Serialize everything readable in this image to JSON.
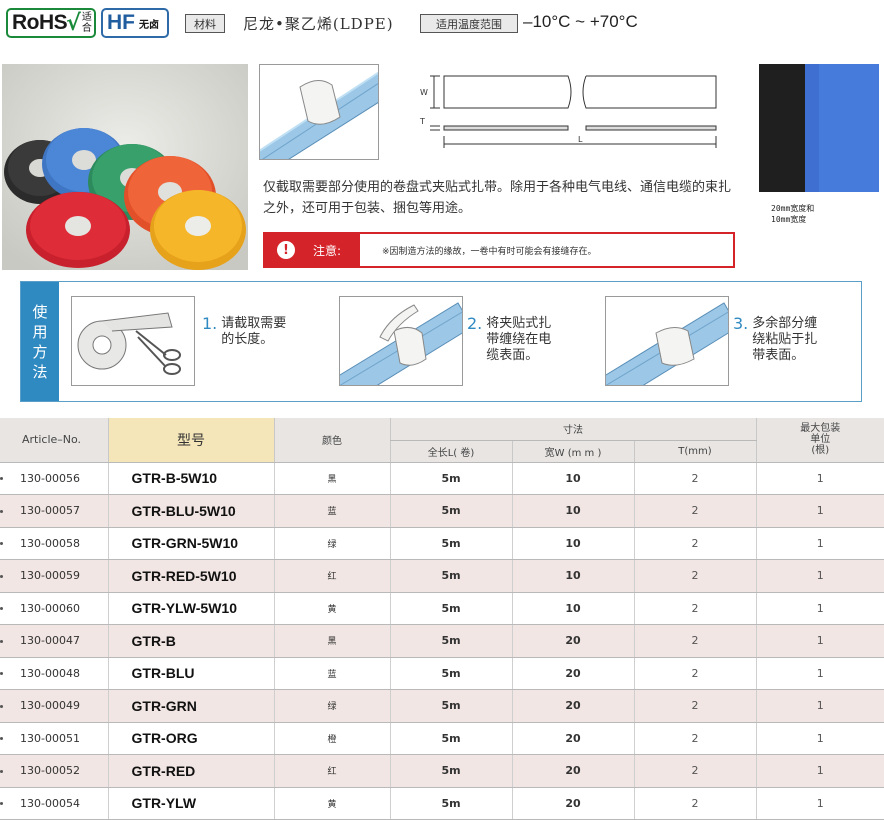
{
  "header": {
    "rohs_text": "RoHS",
    "rohs_mark": "√",
    "rohs_sub_1": "适",
    "rohs_sub_2": "合",
    "hf_text": "HF",
    "hf_sub": "无卤",
    "material_label": "材料",
    "material_value": "尼龙•聚乙烯(LDPE)",
    "temp_label": "适用温度范围",
    "temp_value": "–10°C ~ +70°C"
  },
  "drawing": {
    "w_label": "W",
    "t_label": "T",
    "l_label": "L"
  },
  "side_caption": [
    "20mm宽度和",
    "10mm宽度"
  ],
  "description": "仅截取需要部分使用的卷盘式夹贴式扎带。除用于各种电气电线、通信电缆的束扎之外，还可用于包装、捆包等用途。",
  "warning": {
    "icon": "!",
    "label": "注意:",
    "message": "※因制造方法的缘故，一卷中有时可能会有接缝存在。"
  },
  "usage": {
    "side_title": [
      "使",
      "用",
      "方",
      "法"
    ],
    "steps": [
      {
        "num": "1.",
        "text": [
          "请截取需要",
          "的长度。"
        ]
      },
      {
        "num": "2.",
        "text": [
          "将夹贴式扎",
          "带缠绕在电",
          "缆表面。"
        ]
      },
      {
        "num": "3.",
        "text": [
          "多余部分缠",
          "绕粘贴于扎",
          "带表面。"
        ]
      }
    ]
  },
  "table": {
    "headers": {
      "article": "Article–No.",
      "model": "型号",
      "color": "颜色",
      "dimensions": "寸法",
      "length": "全长L( 卷)",
      "width": "宽W (m m )",
      "t": "T(mm)",
      "pack": [
        "最大包装",
        "单位",
        "(根)"
      ]
    },
    "rows": [
      {
        "article": "130-00056",
        "model": "GTR-B-5W10",
        "color": "黑",
        "length": "5m",
        "width": "10",
        "t": "2",
        "pack": "1"
      },
      {
        "article": "130-00057",
        "model": "GTR-BLU-5W10",
        "color": "蓝",
        "length": "5m",
        "width": "10",
        "t": "2",
        "pack": "1"
      },
      {
        "article": "130-00058",
        "model": "GTR-GRN-5W10",
        "color": "绿",
        "length": "5m",
        "width": "10",
        "t": "2",
        "pack": "1"
      },
      {
        "article": "130-00059",
        "model": "GTR-RED-5W10",
        "color": "红",
        "length": "5m",
        "width": "10",
        "t": "2",
        "pack": "1"
      },
      {
        "article": "130-00060",
        "model": "GTR-YLW-5W10",
        "color": "黄",
        "length": "5m",
        "width": "10",
        "t": "2",
        "pack": "1"
      },
      {
        "article": "130-00047",
        "model": "GTR-B",
        "color": "黑",
        "length": "5m",
        "width": "20",
        "t": "2",
        "pack": "1"
      },
      {
        "article": "130-00048",
        "model": "GTR-BLU",
        "color": "蓝",
        "length": "5m",
        "width": "20",
        "t": "2",
        "pack": "1"
      },
      {
        "article": "130-00049",
        "model": "GTR-GRN",
        "color": "绿",
        "length": "5m",
        "width": "20",
        "t": "2",
        "pack": "1"
      },
      {
        "article": "130-00051",
        "model": "GTR-ORG",
        "color": "橙",
        "length": "5m",
        "width": "20",
        "t": "2",
        "pack": "1"
      },
      {
        "article": "130-00052",
        "model": "GTR-RED",
        "color": "红",
        "length": "5m",
        "width": "20",
        "t": "2",
        "pack": "1"
      },
      {
        "article": "130-00054",
        "model": "GTR-YLW",
        "color": "黄",
        "length": "5m",
        "width": "20",
        "t": "2",
        "pack": "1"
      }
    ]
  },
  "colors": {
    "rohs_green": "#1a8a3a",
    "hf_blue": "#1f5d9f",
    "warning_red": "#d4242a",
    "usage_blue": "#2f8ac1",
    "model_header": "#f4e6b8",
    "alt_row": "#f1e6e3"
  }
}
